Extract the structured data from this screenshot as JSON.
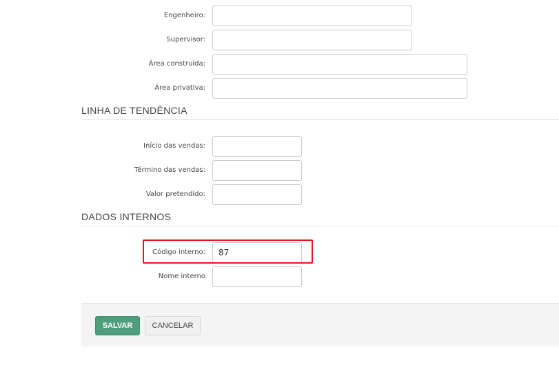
{
  "fields": {
    "engenheiro": {
      "label": "Engenheiro:",
      "value": ""
    },
    "supervisor": {
      "label": "Supervisor:",
      "value": ""
    },
    "area_construida": {
      "label": "Área construída:",
      "value": ""
    },
    "area_privativa": {
      "label": "Área privativa:",
      "value": ""
    }
  },
  "sections": {
    "linha_tendencia": {
      "title": "LINHA DE TENDÊNCIA",
      "inicio_vendas": {
        "label": "Início das vendas:",
        "value": ""
      },
      "termino_vendas": {
        "label": "Término das vendas:",
        "value": ""
      },
      "valor_pretendido": {
        "label": "Valor pretendido:",
        "value": ""
      }
    },
    "dados_internos": {
      "title": "DADOS INTERNOS",
      "codigo_interno": {
        "label": "Código interno:",
        "value": "87"
      },
      "nome_interno": {
        "label": "Nome interno",
        "value": ""
      }
    }
  },
  "footer": {
    "save_label": "SALVAR",
    "cancel_label": "CANCELAR"
  },
  "colors": {
    "primary_button": "#4e9e7d",
    "highlight": "#e8141c",
    "footer_background": "#f4f4f4"
  }
}
